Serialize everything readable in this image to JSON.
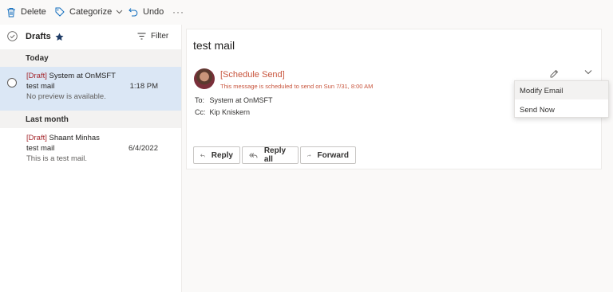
{
  "toolbar": {
    "delete_label": "Delete",
    "categorize_label": "Categorize",
    "undo_label": "Undo",
    "more_label": "···"
  },
  "list": {
    "title": "Drafts",
    "filter_label": "Filter",
    "groups": [
      {
        "label": "Today",
        "items": [
          {
            "draft_tag": "[Draft]",
            "sender": "System at OnMSFT",
            "subject": "test mail",
            "time": "1:18 PM",
            "preview": "No preview is available.",
            "selected": true
          }
        ]
      },
      {
        "label": "Last month",
        "items": [
          {
            "draft_tag": "[Draft]",
            "sender": "Shaant Minhas",
            "subject": "test mail",
            "time": "6/4/2022",
            "preview": "This is a test mail.",
            "selected": false
          }
        ]
      }
    ]
  },
  "reading": {
    "subject": "test mail",
    "schedule_label": "[Schedule Send]",
    "schedule_note": "This message is scheduled to send on Sun 7/31, 8:00 AM",
    "to_label": "To:",
    "to_value": "System at OnMSFT",
    "cc_label": "Cc:",
    "cc_value": "Kip Kniskern",
    "actions": {
      "reply": "Reply",
      "reply_all": "Reply all",
      "forward": "Forward"
    }
  },
  "dropdown": {
    "items": [
      "Modify Email",
      "Send Now"
    ]
  },
  "colors": {
    "accent": "#0f6cbd",
    "draft": "#a4262c",
    "schedule": "#c8553d",
    "selected_row": "#dbe7f5"
  },
  "icons": {
    "delete": "trash-icon",
    "categorize": "tag-icon",
    "undo": "undo-icon",
    "check": "check-circle-icon",
    "star": "star-icon",
    "filter": "filter-icon",
    "edit": "pencil-icon",
    "chevron": "chevron-down-icon",
    "reply": "reply-icon",
    "reply_all": "reply-all-icon",
    "forward": "forward-icon"
  }
}
